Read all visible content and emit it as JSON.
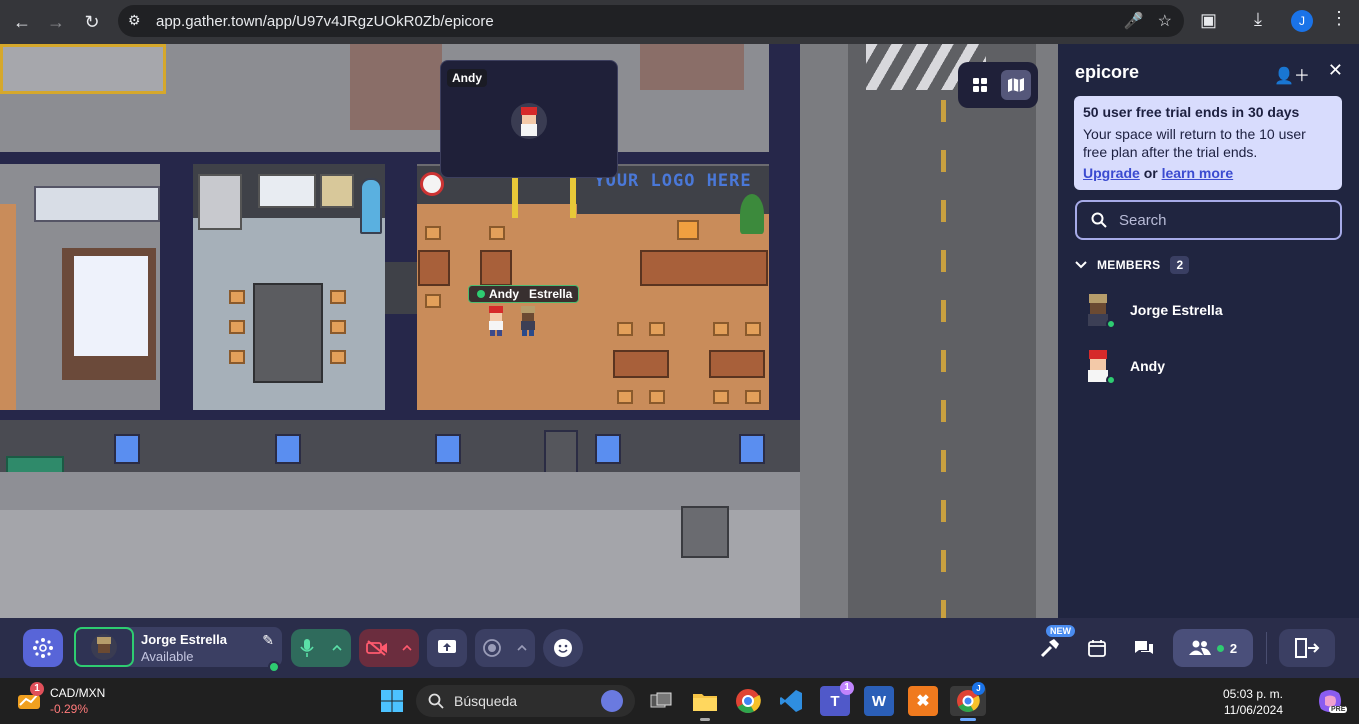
{
  "browser": {
    "url": "app.gather.town/app/U97v4JRgzUOkR0Zb/epicore",
    "profile_initial": "J"
  },
  "map": {
    "logo_text": "YOUR LOGO HERE",
    "name_tag": "Andy",
    "name_tag_2": "Estrella",
    "video_tile_label": "Andy"
  },
  "panel": {
    "title": "epicore",
    "trial_heading": "50 user free trial ends in 30 days",
    "trial_body": "Your space will return to the 10 user free plan after the trial ends.",
    "upgrade_link": "Upgrade",
    "or_text": "or",
    "learn_more_link": "learn more",
    "search_placeholder": "Search",
    "members_label": "MEMBERS",
    "members_count": "2",
    "members": [
      {
        "name": "Jorge Estrella",
        "status": "online"
      },
      {
        "name": "Andy",
        "status": "online"
      }
    ]
  },
  "bottombar": {
    "user_name": "Jorge Estrella",
    "user_status": "Available",
    "new_badge": "NEW",
    "participants_count": "2"
  },
  "taskbar": {
    "ticker_symbol": "CAD/MXN",
    "ticker_change": "-0.29%",
    "ticker_badge": "1",
    "search_text": "Búsqueda",
    "teams_badge": "1",
    "time": "05:03 p. m.",
    "date": "11/06/2024",
    "copilot_label": "PRE"
  },
  "colors": {
    "panel_bg": "#202540",
    "bottombar_bg": "#2a2d4a",
    "online": "#2ecc71",
    "trial_bg": "#d8dcfd",
    "mic_on": "#2f6b5c",
    "camera_off": "#6b2d3e"
  }
}
